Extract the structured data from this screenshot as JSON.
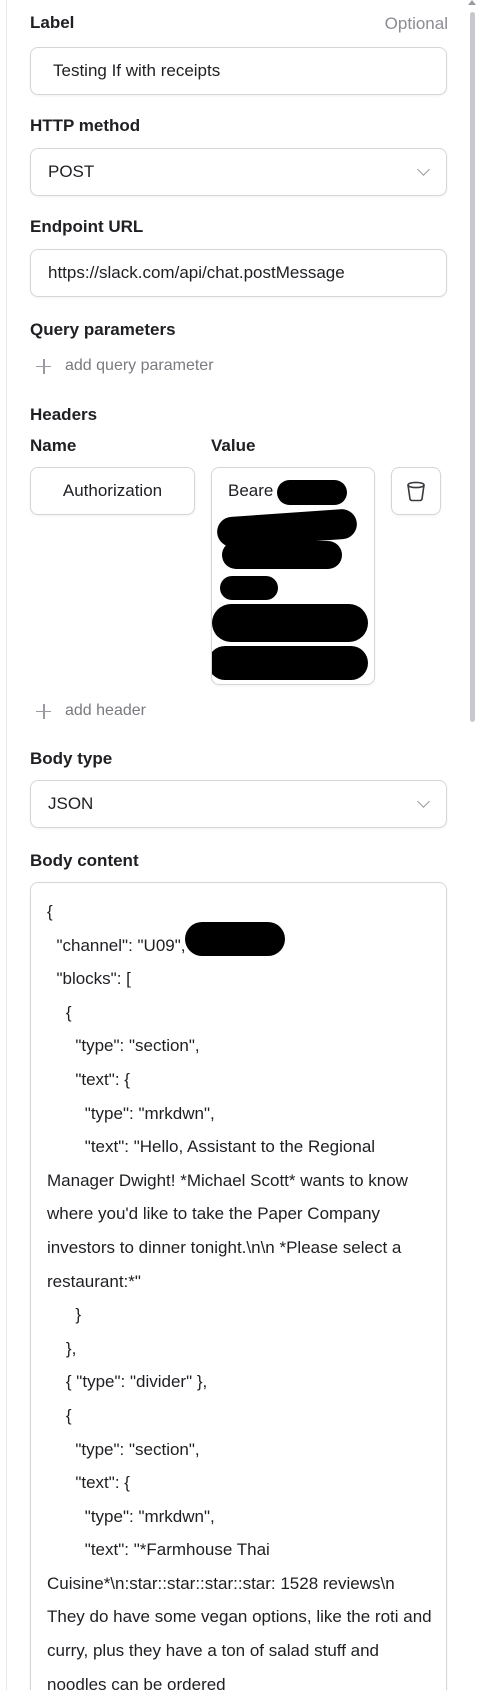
{
  "label": {
    "title": "Label",
    "optional": "Optional",
    "value": "Testing If with receipts"
  },
  "http_method": {
    "title": "HTTP method",
    "value": "POST"
  },
  "endpoint": {
    "title": "Endpoint URL",
    "value": "https://slack.com/api/chat.postMessage"
  },
  "query": {
    "title": "Query parameters",
    "add_label": "add query parameter"
  },
  "headers": {
    "title": "Headers",
    "name_col": "Name",
    "value_col": "Value",
    "rows": [
      {
        "name": "Authorization",
        "value": "Beare"
      }
    ],
    "add_label": "add header"
  },
  "body_type": {
    "title": "Body type",
    "value": "JSON"
  },
  "body_content": {
    "title": "Body content",
    "text": "{\n  \"channel\": \"U09\",\n  \"blocks\": [\n    {\n      \"type\": \"section\",\n      \"text\": {\n        \"type\": \"mrkdwn\",\n        \"text\": \"Hello, Assistant to the Regional Manager Dwight! *Michael Scott* wants to know where you'd like to take the Paper Company investors to dinner tonight.\\n\\n *Please select a restaurant:*\"\n      }\n    },\n    { \"type\": \"divider\" },\n    {\n      \"type\": \"section\",\n      \"text\": {\n        \"type\": \"mrkdwn\",\n        \"text\": \"*Farmhouse Thai Cuisine*\\n:star::star::star::star: 1528 reviews\\n They do have some vegan options, like the roti and curry, plus they have a ton of salad stuff and noodles can be ordered"
  },
  "icons": {
    "delete": "trash-icon",
    "dropdown": "chevron-down-icon",
    "add": "plus-icon"
  },
  "colors": {
    "border": "#d6d6da",
    "muted_text": "#8b8b92",
    "redaction": "#000000"
  }
}
